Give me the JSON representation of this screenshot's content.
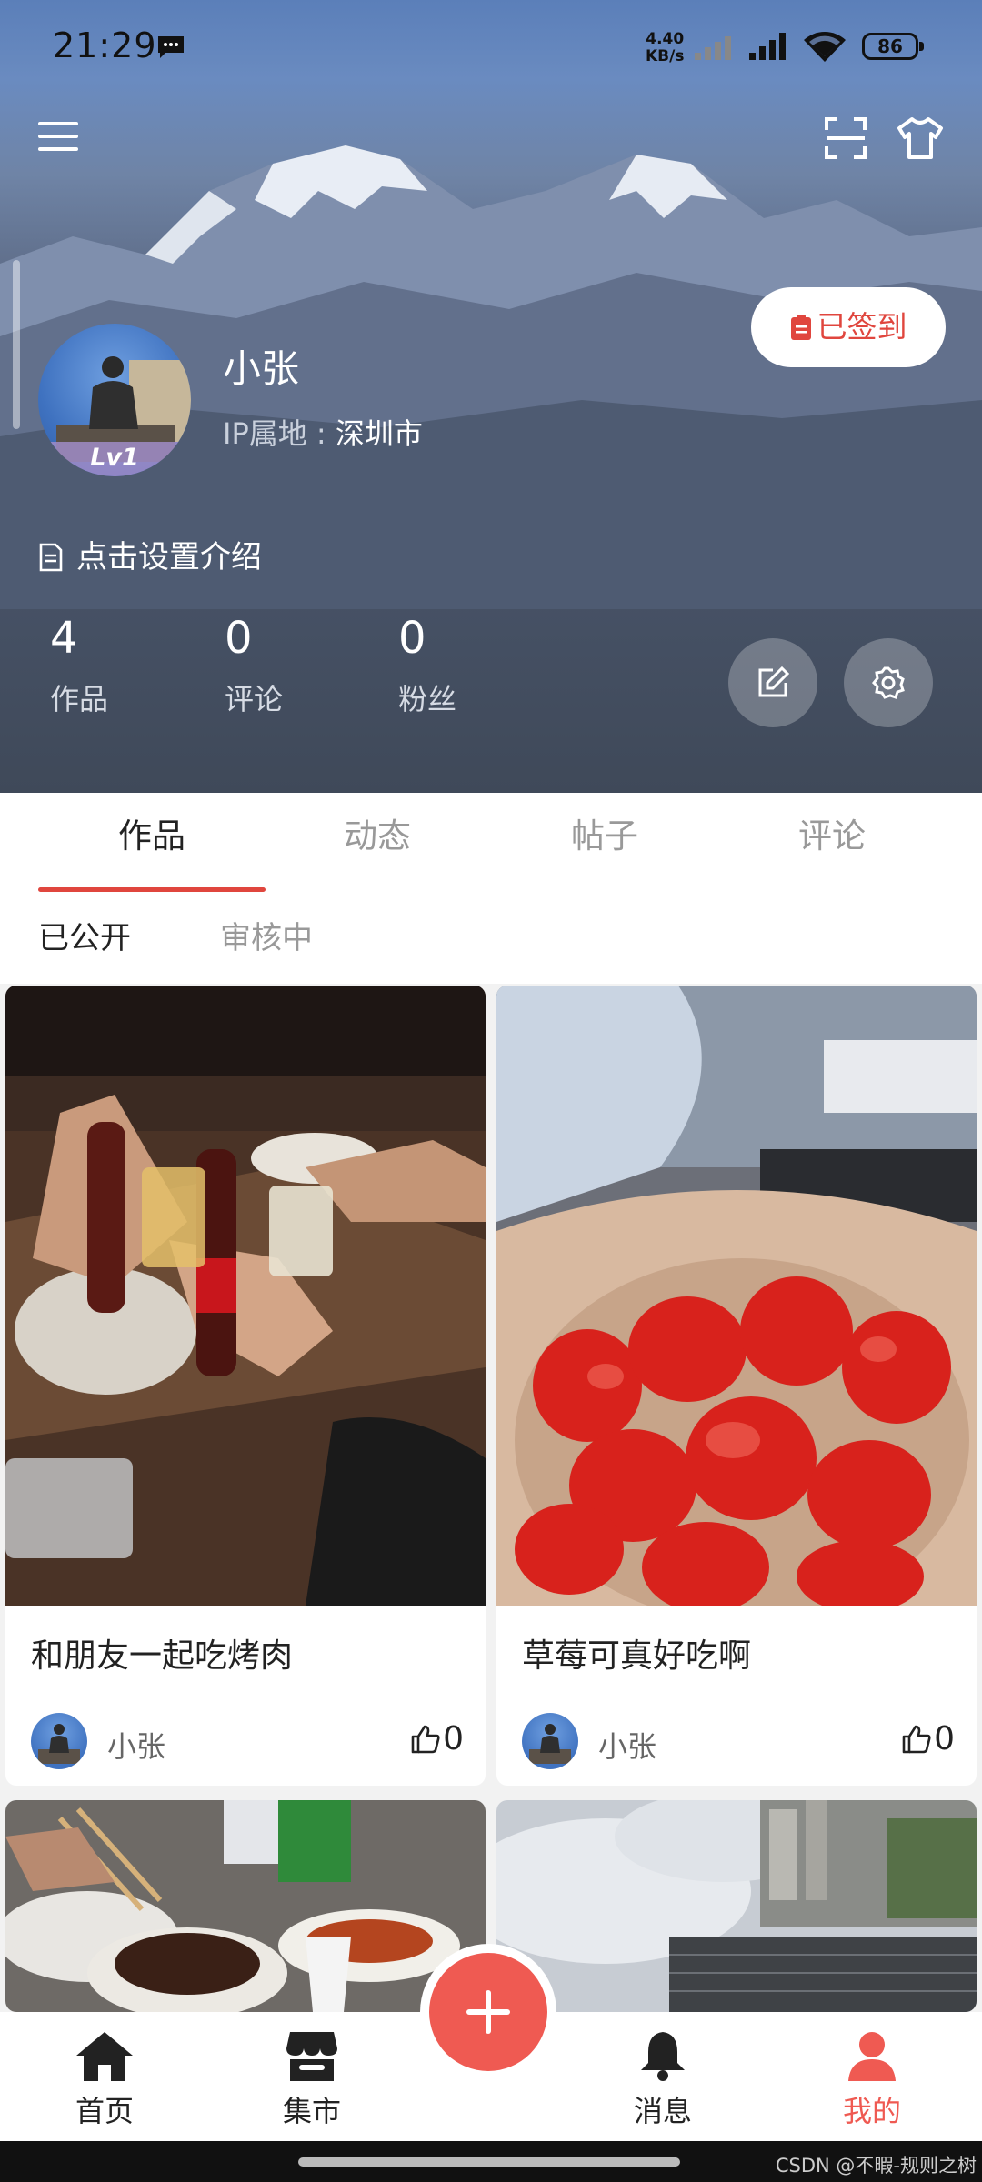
{
  "status_bar": {
    "time": "21:29",
    "net_speed_value": "4.40",
    "net_speed_unit": "KB/s",
    "battery": "86"
  },
  "profile": {
    "name": "小张",
    "level": "Lv1",
    "ip_label": "IP属地 : ",
    "ip_city": "深圳市",
    "sign_in_label": "已签到",
    "intro_prompt": "点击设置介绍",
    "stats": [
      {
        "value": "4",
        "label": "作品"
      },
      {
        "value": "0",
        "label": "评论"
      },
      {
        "value": "0",
        "label": "粉丝"
      }
    ]
  },
  "tabs": [
    "作品",
    "动态",
    "帖子",
    "评论"
  ],
  "active_tab": "作品",
  "sub_tabs": [
    "已公开",
    "审核中"
  ],
  "active_sub_tab": "已公开",
  "posts": [
    {
      "title": "和朋友一起吃烤肉",
      "author": "小张",
      "likes": "0",
      "image": "cola-toast-photo"
    },
    {
      "title": "草莓可真好吃啊",
      "author": "小张",
      "likes": "0",
      "image": "strawberry-bowl-photo"
    },
    {
      "image": "dinner-table-photo"
    },
    {
      "image": "city-skyline-photo"
    }
  ],
  "bottom_nav": [
    {
      "label": "首页",
      "icon": "home-icon"
    },
    {
      "label": "集市",
      "icon": "market-icon"
    },
    {
      "label": "消息",
      "icon": "bell-icon"
    },
    {
      "label": "我的",
      "icon": "person-icon"
    }
  ],
  "colors": {
    "accent": "#ef5a52",
    "signed_text": "#e0463e"
  },
  "watermark": "CSDN @不暇-规则之树"
}
